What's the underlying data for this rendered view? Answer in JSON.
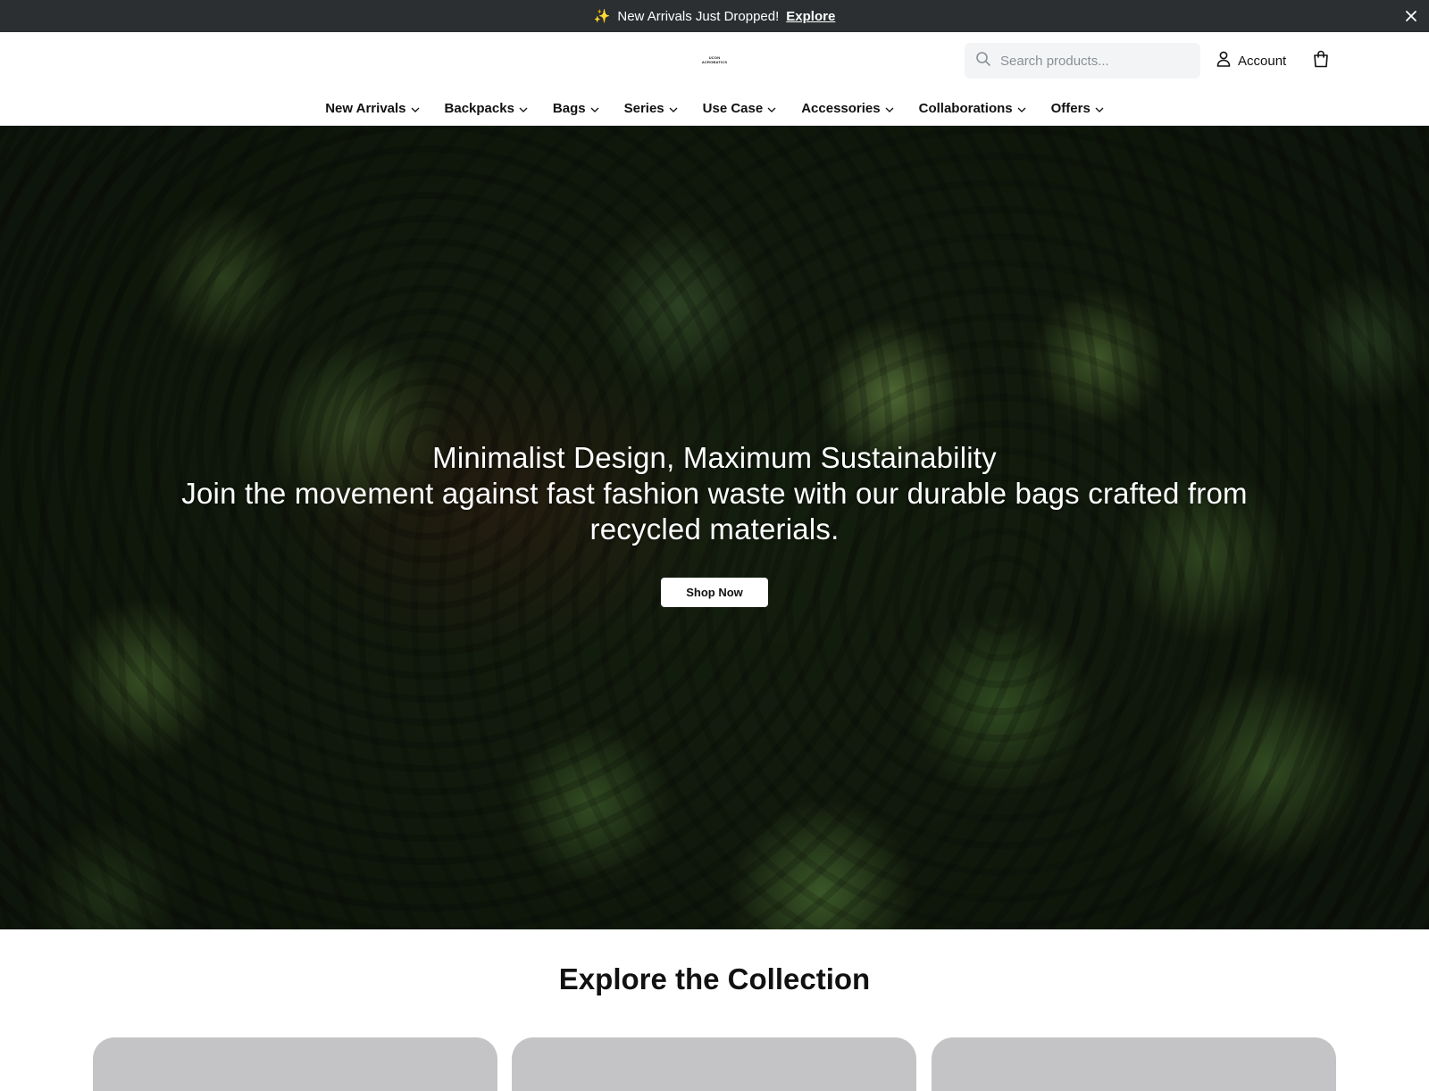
{
  "announcement": {
    "sparkle_icon": "✨",
    "message": "New Arrivals Just Dropped!",
    "link_label": "Explore"
  },
  "header": {
    "logo_line1": "UCON",
    "logo_line2": "ACROBATICS",
    "search_placeholder": "Search products...",
    "account_label": "Account"
  },
  "nav": {
    "items": [
      {
        "label": "New Arrivals"
      },
      {
        "label": "Backpacks"
      },
      {
        "label": "Bags"
      },
      {
        "label": "Series"
      },
      {
        "label": "Use Case"
      },
      {
        "label": "Accessories"
      },
      {
        "label": "Collaborations"
      },
      {
        "label": "Offers"
      }
    ]
  },
  "hero": {
    "headline": "Minimalist Design, Maximum Sustainability",
    "subtext": "Join the movement against fast fashion waste with our durable bags crafted from recycled materials.",
    "cta_label": "Shop Now"
  },
  "collection": {
    "title": "Explore the Collection"
  },
  "colors": {
    "announcement_bg": "#2b2f31",
    "card_placeholder": "#c4c4c6",
    "search_bg": "#f3f4f6"
  }
}
